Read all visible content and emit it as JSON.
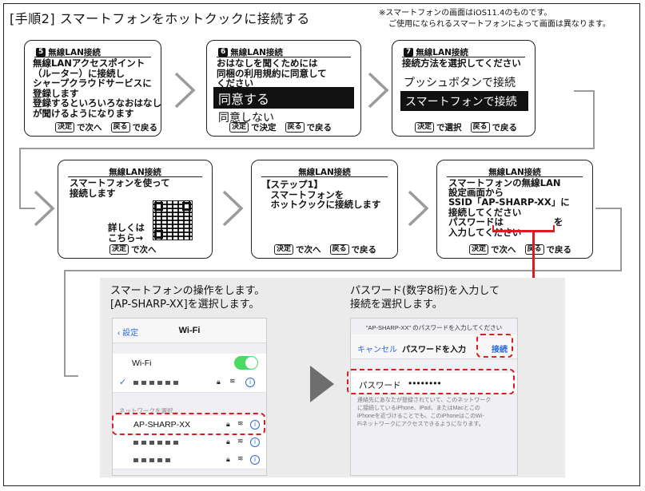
{
  "title": "[手順2] スマートフォンをホットクックに接続する",
  "note": [
    "※スマートフォンの画面はiOS11.4のものです。",
    "ご使用になられるスマートフォンによって画面は異なります。"
  ],
  "keys": {
    "kettei": "決定",
    "modoru": "戻る"
  },
  "panels": {
    "p5": {
      "num": "5",
      "header": "無線LAN接続",
      "body": "無線LANアクセスポイント\n（ルーター）に接続し\nシャープクラウドサービスに\n登録します\n登録するといろいろなおはなし\nが聞けるようになります",
      "f1": "で次へ",
      "f2": "で戻る"
    },
    "p6": {
      "num": "6",
      "header": "無線LAN接続",
      "body": "おはなしを聞くためには\n同梱の利用規約に同意して\nください",
      "selected": "同意する",
      "other": "同意しない",
      "f1": "で決定",
      "f2": "で戻る"
    },
    "p7": {
      "num": "7",
      "header": "無線LAN接続",
      "body": "接続方法を選択してください",
      "option1": "プッシュボタンで接続",
      "selected": "スマートフォンで接続",
      "f1": "で選択",
      "f2": "で戻る"
    },
    "p8": {
      "header": "無線LAN接続",
      "body": "スマートフォンを使って\n接続します",
      "qr_text": "詳しくは\nこちら→",
      "f1": "で次へ"
    },
    "p9": {
      "header": "無線LAN接続",
      "body": "【ステップ1】\n　スマートフォンを\n　ホットクックに接続します",
      "f1": "で次へ",
      "f2": "で戻る"
    },
    "p10": {
      "header": "無線LAN接続",
      "body": "スマートフォンの無線LAN\n設定画面から\nSSID「AP-SHARP-XX」に\n接続してください\nパスワードは",
      "body2": "を",
      "body3": "入力してください",
      "f1": "で次へ",
      "f2": "で戻る"
    }
  },
  "caption_left": "スマートフォンの操作をします。\n[AP-SHARP-XX]を選択します。",
  "caption_right": "パスワード(数字8桁)を入力して\n接続を選択します。",
  "wifi_screen": {
    "back": "設定",
    "title": "Wi-Fi",
    "wifi_label": "Wi-Fi",
    "section": "ネットワークを選択...",
    "target_ssid": "AP-SHARP-XX",
    "colors": {
      "toggle": "#4cd964",
      "link": "#2a6ad8",
      "highlight": "#d42020"
    }
  },
  "pw_screen": {
    "prompt": "\"AP-SHARP-XX\" のパスワードを入力してください",
    "cancel": "キャンセル",
    "title": "パスワードを入力",
    "join": "接続",
    "pw_label": "パスワード",
    "pw_value": "••••••••",
    "footnote": "連絡先にあなたが登録されていて、このネットワーク\nに接続しているiPhone、iPad、またはMacとこの\niPhoneを近づけることでも、このiPhoneはこのWi-\nFiネットワークにアクセスできるようになります。"
  }
}
